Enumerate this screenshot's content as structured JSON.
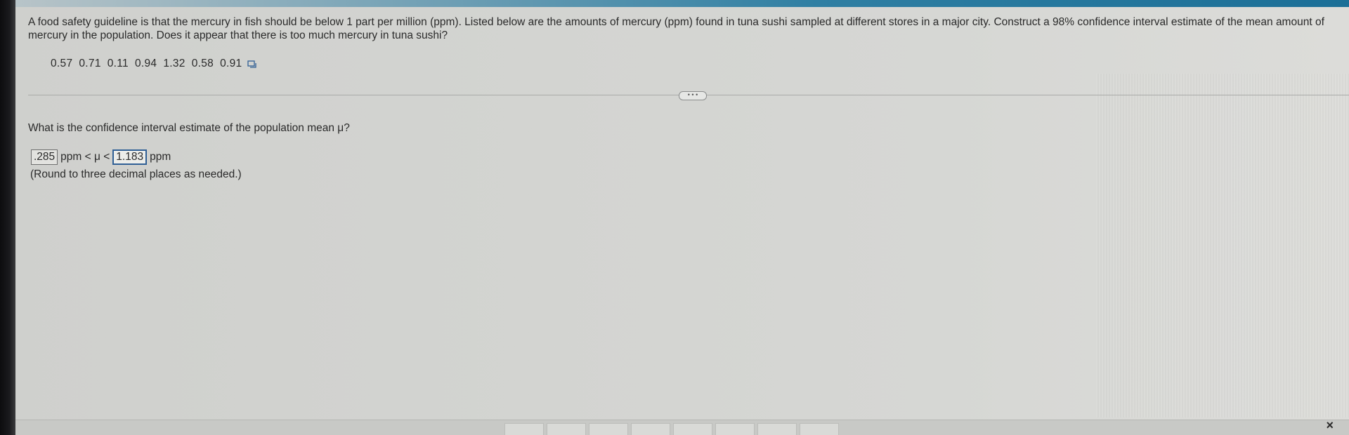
{
  "question": {
    "text": "A food safety guideline is that the mercury in fish should be below 1 part per million (ppm). Listed below are the amounts of mercury (ppm) found in tuna sushi sampled at different stores in a major city. Construct a 98% confidence interval estimate of the mean amount of mercury in the population. Does it appear that there is too much mercury in tuna sushi?"
  },
  "data": {
    "values": [
      "0.57",
      "0.71",
      "0.11",
      "0.94",
      "1.32",
      "0.58",
      "0.91"
    ],
    "copy_icon": "copy-data-icon"
  },
  "more_button": {
    "label": "• • •"
  },
  "sub_question": {
    "text": "What is the confidence interval estimate of the population mean μ?"
  },
  "answer": {
    "lower_value": ".285",
    "upper_value": "1.183",
    "between_text": "ppm < μ <",
    "unit_text": "ppm"
  },
  "hint": {
    "text": "(Round to three decimal places as needed.)"
  },
  "footer": {
    "close_label": "×"
  }
}
